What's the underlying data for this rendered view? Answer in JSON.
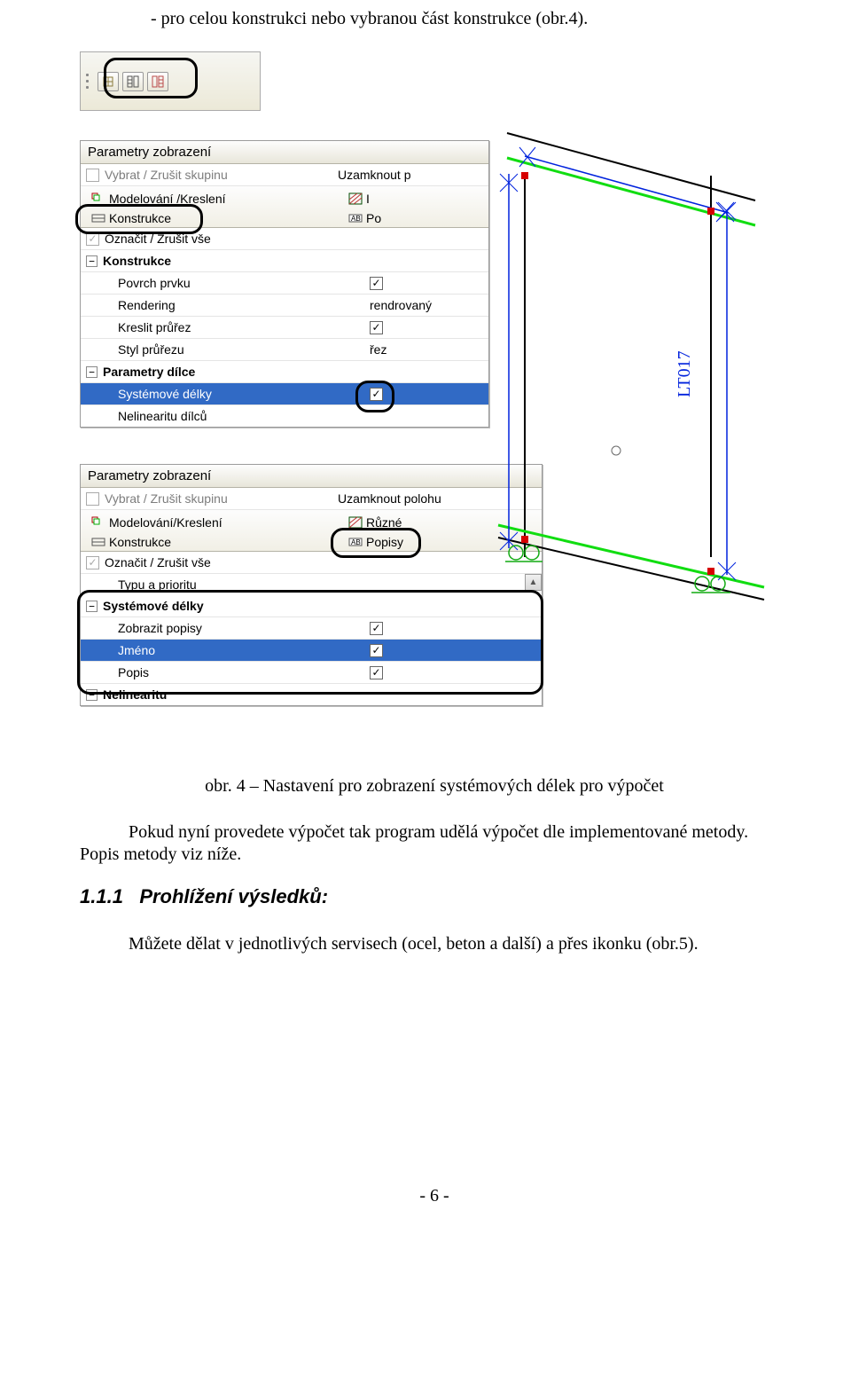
{
  "top_text": "- pro celou konstrukci nebo vybranou část konstrukce (obr.4).",
  "panel1": {
    "title": "Parametry zobrazení",
    "group_toggle": "Vybrat / Zrušit skupinu",
    "lock_label": "Uzamknout p",
    "tabs": {
      "modeling": "Modelování /Kreslení",
      "right_letter": "I",
      "konstrukce": "Konstrukce",
      "po": "Po"
    },
    "mark_all": "Označit / Zrušit vše",
    "rows": {
      "group_konstrukce": "Konstrukce",
      "povrch": "Povrch prvku",
      "rendering_label": "Rendering",
      "rendering_value": "rendrovaný",
      "kreslit": "Kreslit průřez",
      "styl_label": "Styl průřezu",
      "styl_value": "řez",
      "group_dilce": "Parametry dílce",
      "sys_delky": "Systémové délky",
      "nelinearity": "Nelinearitu dílců"
    }
  },
  "panel2": {
    "title": "Parametry zobrazení",
    "group_toggle": "Vybrat / Zrušit skupinu",
    "lock_label": "Uzamknout polohu",
    "tabs": {
      "modeling": "Modelování/Kreslení",
      "ruzne": "Různé",
      "konstrukce": "Konstrukce",
      "popisy": "Popisy"
    },
    "mark_all": "Označit / Zrušit vše",
    "rows": {
      "typ_priority": "Typu a prioritu",
      "sys_delky": "Systémové délky",
      "zobrazit_popisy": "Zobrazit popisy",
      "jmeno": "Jméno",
      "popis": "Popis",
      "nelinearity": "Nelinearitu"
    }
  },
  "caption": "obr. 4 – Nastavení pro zobrazení systémových délek pro výpočet",
  "paragraph": "Pokud nyní provedete výpočet tak program udělá výpočet dle implementované metody. Popis metody viz níže.",
  "heading_num": "1.1.1",
  "heading_text": "Prohlížení výsledků:",
  "paragraph2": "Můžete dělat v jednotlivých servisech (ocel, beton a další) a přes ikonku (obr.5).",
  "page_number": "- 6 -"
}
